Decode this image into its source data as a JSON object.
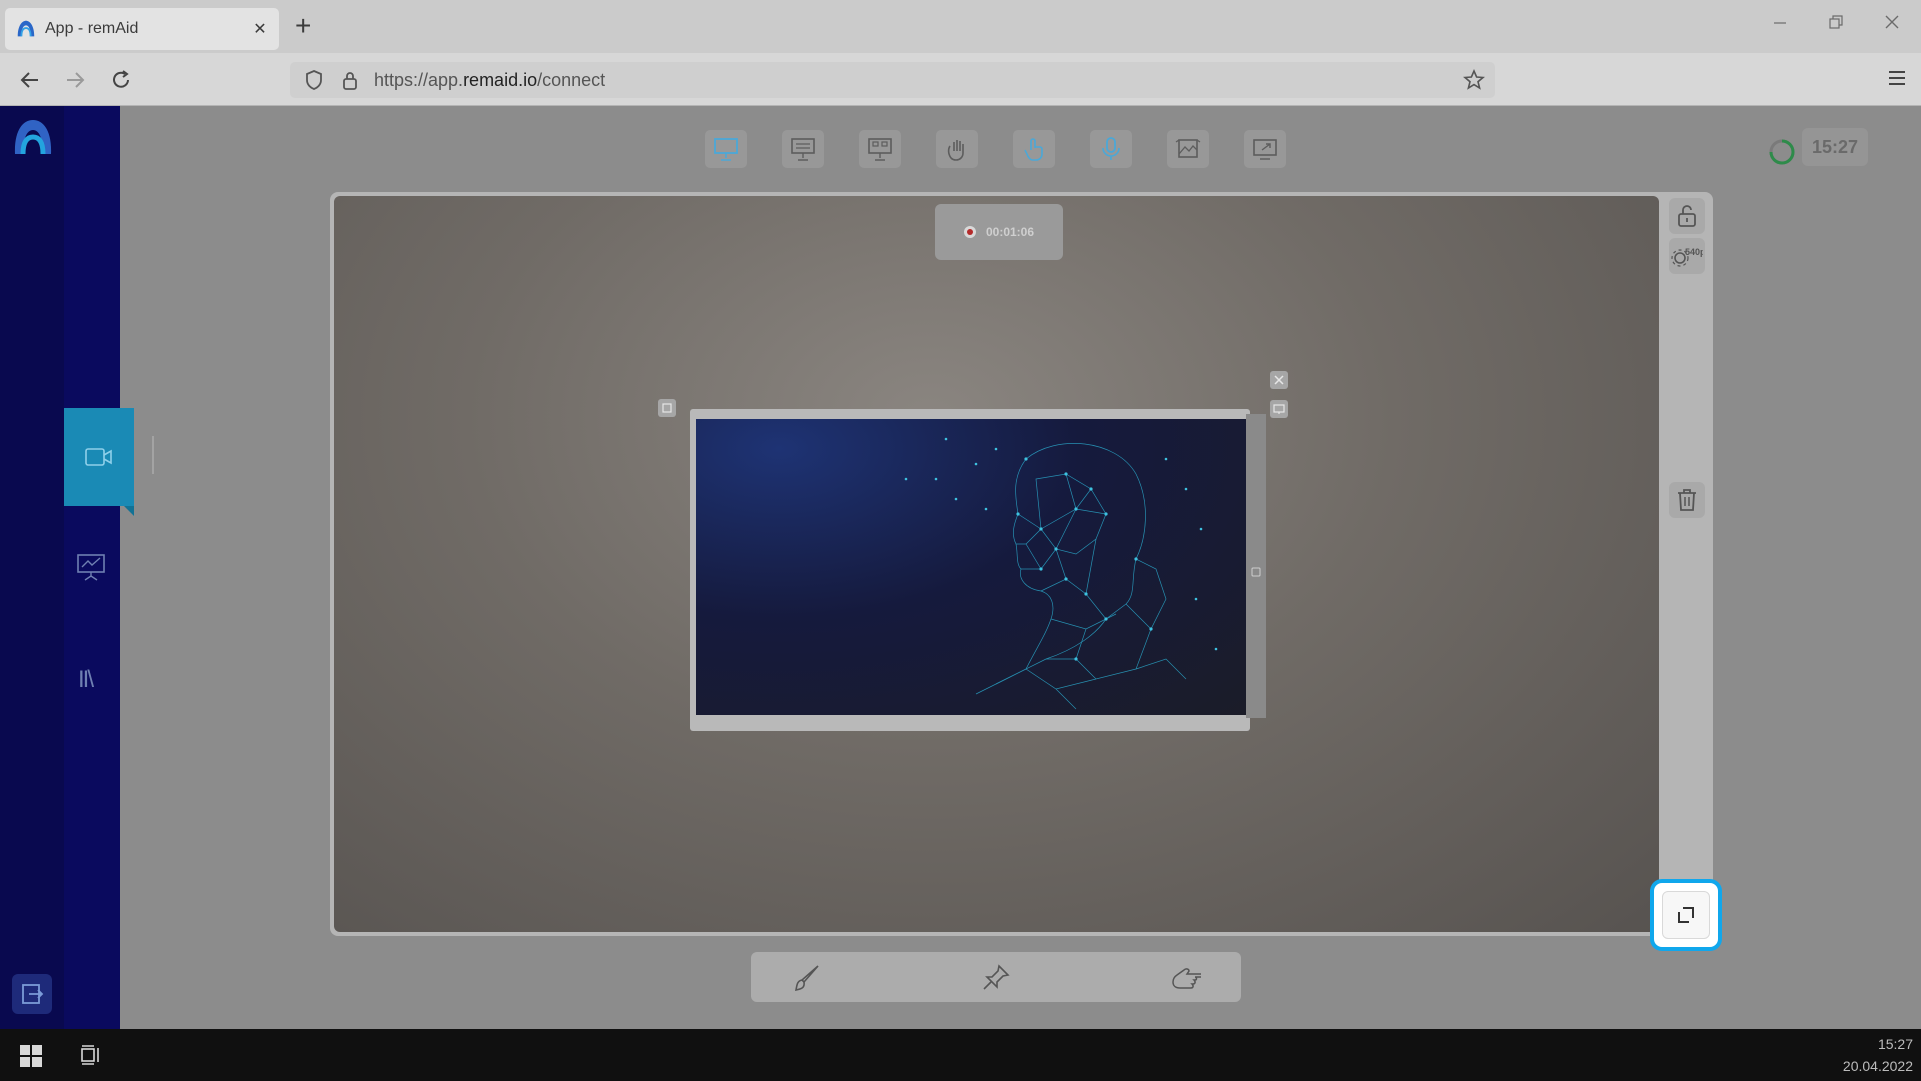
{
  "browser": {
    "tab_title": "App - remAid",
    "tab_close": "✕",
    "new_tab": "+",
    "url_prefix": "https://app.",
    "url_domain": "remaid.io",
    "url_path": "/connect"
  },
  "sidebar": {
    "items": [
      {
        "name": "video-call",
        "active": true
      },
      {
        "name": "presentation",
        "active": false
      },
      {
        "name": "library",
        "active": false
      }
    ],
    "library_glyph": "II\\"
  },
  "toolbar": {
    "tools": [
      "presentation-board-icon",
      "presentation-settings-icon",
      "presentation-grid-icon",
      "hand-gesture-icon",
      "touch-pointer-icon",
      "microphone-icon",
      "image-crop-icon",
      "screen-share-icon"
    ],
    "clock": "15:27"
  },
  "recording": {
    "time": "00:01:06"
  },
  "right_panel": {
    "quality_label": "540p"
  },
  "bottom_tools": [
    "brush-icon",
    "pin-icon",
    "pointing-hand-icon"
  ],
  "taskbar": {
    "time": "15:27",
    "date": "20.04.2022"
  },
  "colors": {
    "sidebar": "#0a0a5e",
    "accent": "#1a8ab5",
    "highlight": "#10a7ec"
  }
}
